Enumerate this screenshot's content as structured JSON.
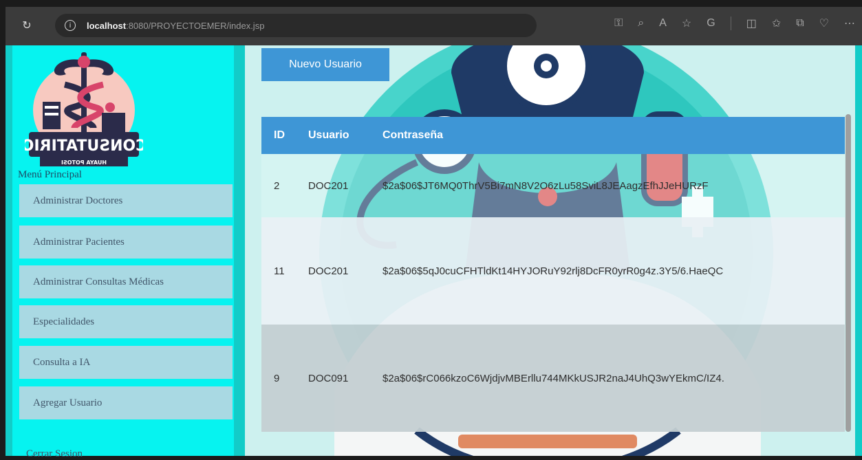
{
  "browser": {
    "url_host": "localhost",
    "url_path": ":8080/PROYECTOEMER/index.jsp"
  },
  "sidebar": {
    "logo_text": "CONSUTATIRIO",
    "logo_subtext": "HUAYA POTOSI",
    "menu_title": "Menú Principal",
    "items": [
      {
        "label": "Administrar Doctores"
      },
      {
        "label": "Administrar Pacientes"
      },
      {
        "label": "Administrar Consultas Médicas"
      },
      {
        "label": "Especialidades"
      },
      {
        "label": "Consulta a IA"
      },
      {
        "label": "Agregar Usuario"
      }
    ],
    "logout_label": "Cerrar Sesion"
  },
  "main": {
    "new_user_label": "Nuevo Usuario",
    "table": {
      "headers": [
        "ID",
        "Usuario",
        "Contraseña"
      ],
      "rows": [
        {
          "id": "2",
          "usuario": "DOC201",
          "password": "$2a$06$JT6MQ0ThrV5Bi7mN8V2O6zLu58SviL8JEAagzEfhJJeHURzF"
        },
        {
          "id": "11",
          "usuario": "DOC201",
          "password": "$2a$06$5qJ0cuCFHTldKt14HYJORuY92rlj8DcFR0yrR0g4z.3Y5/6.HaeQC"
        },
        {
          "id": "9",
          "usuario": "DOC091",
          "password": "$2a$06$rC066kzoC6WjdjvMBErllu744MKkUSJR2naJ4UhQ3wYEkmC/IZ4."
        }
      ]
    }
  }
}
